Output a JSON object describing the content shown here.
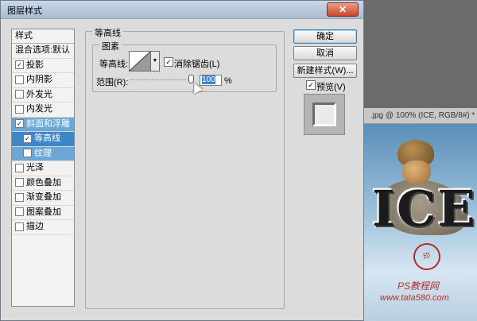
{
  "background_document": {
    "tab_title": ".jpg @ 100% (ICE, RGB/8#) *",
    "image_text": "ICE",
    "watermark_line1": "PS教程网",
    "watermark_line2": "www.tata580.com"
  },
  "dialog": {
    "title": "图层样式",
    "close_label": "✕"
  },
  "styles_panel": {
    "header": "样式",
    "items": [
      {
        "label": "混合选项:默认",
        "checkbox": false,
        "checked": false
      },
      {
        "label": "投影",
        "checkbox": true,
        "checked": true
      },
      {
        "label": "内阴影",
        "checkbox": true,
        "checked": false
      },
      {
        "label": "外发光",
        "checkbox": true,
        "checked": false
      },
      {
        "label": "内发光",
        "checkbox": true,
        "checked": false
      },
      {
        "label": "斜面和浮雕",
        "checkbox": true,
        "checked": true
      },
      {
        "label": "等高线",
        "checkbox": true,
        "checked": true
      },
      {
        "label": "纹理",
        "checkbox": true,
        "checked": false
      },
      {
        "label": "光泽",
        "checkbox": true,
        "checked": false
      },
      {
        "label": "颜色叠加",
        "checkbox": true,
        "checked": false
      },
      {
        "label": "渐变叠加",
        "checkbox": true,
        "checked": false
      },
      {
        "label": "图案叠加",
        "checkbox": true,
        "checked": false
      },
      {
        "label": "描边",
        "checkbox": true,
        "checked": false
      }
    ]
  },
  "contour_section": {
    "group_title": "等高线",
    "subgroup_title": "图素",
    "contour_label": "等高线:",
    "antialias_label": "消除锯齿(L)",
    "antialias_checked": "✓",
    "range_label": "范围(R):",
    "range_value": "100",
    "range_unit": "%"
  },
  "buttons": {
    "ok": "确定",
    "cancel": "取消",
    "new_style": "新建样式(W)...",
    "preview_label": "预览(V)",
    "preview_checked": "✓"
  }
}
